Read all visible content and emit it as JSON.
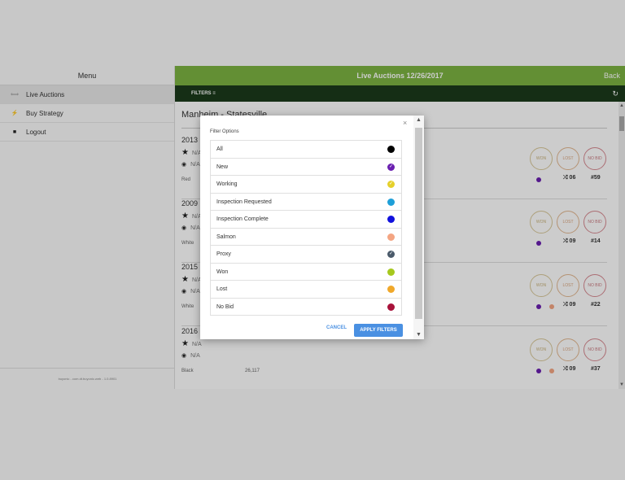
{
  "sidebar": {
    "title": "Menu",
    "items": [
      {
        "icon": "gavel-icon",
        "glyph": "⟺",
        "label": "Live Auctions"
      },
      {
        "icon": "bolt-icon",
        "glyph": "⚡",
        "label": "Buy Strategy"
      },
      {
        "icon": "lock-icon",
        "glyph": "🔒",
        "label": "Logout"
      }
    ],
    "version": "buyonic - com.dt.buyonic.web - 1.0.8901"
  },
  "header": {
    "title": "Live Auctions 12/26/2017",
    "back_label": "Back",
    "accent_color": "#7cb342"
  },
  "filterbar": {
    "filters_label": "FILTERS ≡",
    "refresh_glyph": "↻",
    "bg_color": "#1b3a1b"
  },
  "content": {
    "location": "Manheim - Statesville",
    "vehicles": [
      {
        "year": "2013",
        "rating": "N/A",
        "watch": "N/A",
        "color": "Red",
        "miles": "",
        "won": "WON",
        "lost": "LOST",
        "nobid": "NO BID",
        "dots": [
          "#6a1fb0"
        ],
        "shuffle": "⤮ 06",
        "number": "#59"
      },
      {
        "year": "2009",
        "rating": "N/A",
        "watch": "N/A",
        "color": "White",
        "miles": "",
        "won": "WON",
        "lost": "LOST",
        "nobid": "NO BID",
        "dots": [
          "#6a1fb0"
        ],
        "shuffle": "⤮ 09",
        "number": "#14"
      },
      {
        "year": "2015",
        "rating": "N/A",
        "watch": "N/A",
        "color": "White",
        "miles": "",
        "won": "WON",
        "lost": "LOST",
        "nobid": "NO BID",
        "dots": [
          "#6a1fb0",
          "#f4a582"
        ],
        "shuffle": "⤮ 09",
        "number": "#22"
      },
      {
        "year": "2016",
        "rating": "N/A",
        "watch": "N/A",
        "color": "Black",
        "miles": "26,117",
        "won": "WON",
        "lost": "LOST",
        "nobid": "NO BID",
        "dots": [
          "#6a1fb0",
          "#f4a582"
        ],
        "shuffle": "⤮ 09",
        "number": "#37"
      }
    ]
  },
  "dialog": {
    "heading": "Filter Options",
    "close_glyph": "×",
    "options": [
      {
        "label": "All",
        "color": "#000000",
        "checked": false
      },
      {
        "label": "New",
        "color": "#6a1fb0",
        "checked": true
      },
      {
        "label": "Working",
        "color": "#e5d02a",
        "checked": true
      },
      {
        "label": "Inspection Requested",
        "color": "#1e9fd8",
        "checked": false
      },
      {
        "label": "Inspection Complete",
        "color": "#1111dd",
        "checked": false
      },
      {
        "label": "Salmon",
        "color": "#f4a582",
        "checked": false
      },
      {
        "label": "Proxy",
        "color": "#4a5a6a",
        "checked": true
      },
      {
        "label": "Won",
        "color": "#a6c81e",
        "checked": false
      },
      {
        "label": "Lost",
        "color": "#f0a82a",
        "checked": false
      },
      {
        "label": "No Bid",
        "color": "#a8123a",
        "checked": false
      }
    ],
    "cancel_label": "CANCEL",
    "apply_label": "APPLY FILTERS"
  }
}
